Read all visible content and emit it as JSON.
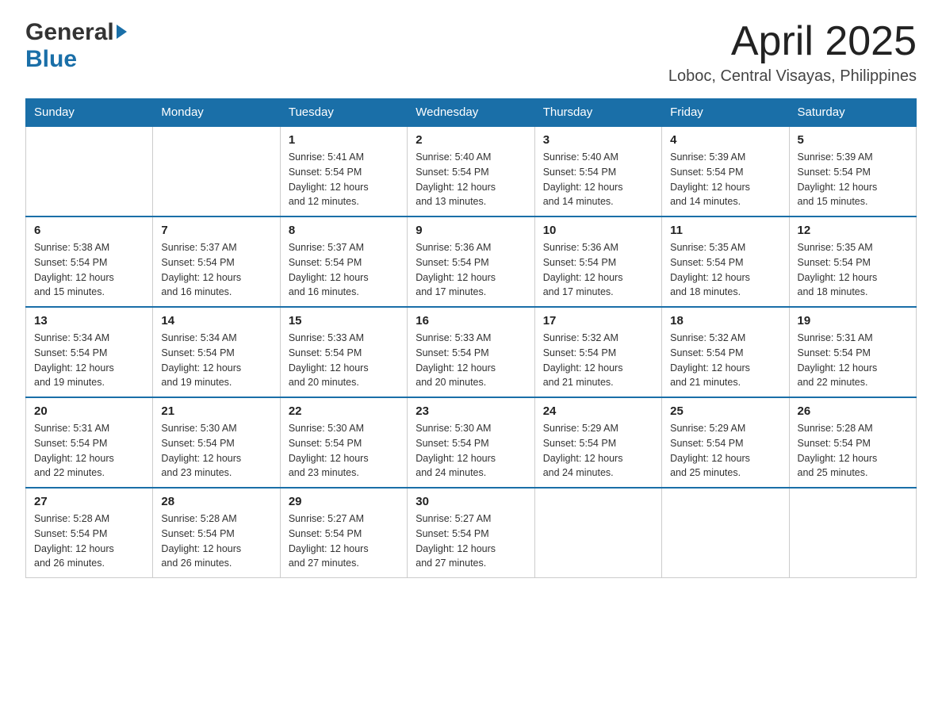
{
  "header": {
    "month_title": "April 2025",
    "location": "Loboc, Central Visayas, Philippines",
    "logo_general": "General",
    "logo_blue": "Blue"
  },
  "days_of_week": [
    "Sunday",
    "Monday",
    "Tuesday",
    "Wednesday",
    "Thursday",
    "Friday",
    "Saturday"
  ],
  "weeks": [
    [
      {
        "day": "",
        "info": ""
      },
      {
        "day": "",
        "info": ""
      },
      {
        "day": "1",
        "info": "Sunrise: 5:41 AM\nSunset: 5:54 PM\nDaylight: 12 hours\nand 12 minutes."
      },
      {
        "day": "2",
        "info": "Sunrise: 5:40 AM\nSunset: 5:54 PM\nDaylight: 12 hours\nand 13 minutes."
      },
      {
        "day": "3",
        "info": "Sunrise: 5:40 AM\nSunset: 5:54 PM\nDaylight: 12 hours\nand 14 minutes."
      },
      {
        "day": "4",
        "info": "Sunrise: 5:39 AM\nSunset: 5:54 PM\nDaylight: 12 hours\nand 14 minutes."
      },
      {
        "day": "5",
        "info": "Sunrise: 5:39 AM\nSunset: 5:54 PM\nDaylight: 12 hours\nand 15 minutes."
      }
    ],
    [
      {
        "day": "6",
        "info": "Sunrise: 5:38 AM\nSunset: 5:54 PM\nDaylight: 12 hours\nand 15 minutes."
      },
      {
        "day": "7",
        "info": "Sunrise: 5:37 AM\nSunset: 5:54 PM\nDaylight: 12 hours\nand 16 minutes."
      },
      {
        "day": "8",
        "info": "Sunrise: 5:37 AM\nSunset: 5:54 PM\nDaylight: 12 hours\nand 16 minutes."
      },
      {
        "day": "9",
        "info": "Sunrise: 5:36 AM\nSunset: 5:54 PM\nDaylight: 12 hours\nand 17 minutes."
      },
      {
        "day": "10",
        "info": "Sunrise: 5:36 AM\nSunset: 5:54 PM\nDaylight: 12 hours\nand 17 minutes."
      },
      {
        "day": "11",
        "info": "Sunrise: 5:35 AM\nSunset: 5:54 PM\nDaylight: 12 hours\nand 18 minutes."
      },
      {
        "day": "12",
        "info": "Sunrise: 5:35 AM\nSunset: 5:54 PM\nDaylight: 12 hours\nand 18 minutes."
      }
    ],
    [
      {
        "day": "13",
        "info": "Sunrise: 5:34 AM\nSunset: 5:54 PM\nDaylight: 12 hours\nand 19 minutes."
      },
      {
        "day": "14",
        "info": "Sunrise: 5:34 AM\nSunset: 5:54 PM\nDaylight: 12 hours\nand 19 minutes."
      },
      {
        "day": "15",
        "info": "Sunrise: 5:33 AM\nSunset: 5:54 PM\nDaylight: 12 hours\nand 20 minutes."
      },
      {
        "day": "16",
        "info": "Sunrise: 5:33 AM\nSunset: 5:54 PM\nDaylight: 12 hours\nand 20 minutes."
      },
      {
        "day": "17",
        "info": "Sunrise: 5:32 AM\nSunset: 5:54 PM\nDaylight: 12 hours\nand 21 minutes."
      },
      {
        "day": "18",
        "info": "Sunrise: 5:32 AM\nSunset: 5:54 PM\nDaylight: 12 hours\nand 21 minutes."
      },
      {
        "day": "19",
        "info": "Sunrise: 5:31 AM\nSunset: 5:54 PM\nDaylight: 12 hours\nand 22 minutes."
      }
    ],
    [
      {
        "day": "20",
        "info": "Sunrise: 5:31 AM\nSunset: 5:54 PM\nDaylight: 12 hours\nand 22 minutes."
      },
      {
        "day": "21",
        "info": "Sunrise: 5:30 AM\nSunset: 5:54 PM\nDaylight: 12 hours\nand 23 minutes."
      },
      {
        "day": "22",
        "info": "Sunrise: 5:30 AM\nSunset: 5:54 PM\nDaylight: 12 hours\nand 23 minutes."
      },
      {
        "day": "23",
        "info": "Sunrise: 5:30 AM\nSunset: 5:54 PM\nDaylight: 12 hours\nand 24 minutes."
      },
      {
        "day": "24",
        "info": "Sunrise: 5:29 AM\nSunset: 5:54 PM\nDaylight: 12 hours\nand 24 minutes."
      },
      {
        "day": "25",
        "info": "Sunrise: 5:29 AM\nSunset: 5:54 PM\nDaylight: 12 hours\nand 25 minutes."
      },
      {
        "day": "26",
        "info": "Sunrise: 5:28 AM\nSunset: 5:54 PM\nDaylight: 12 hours\nand 25 minutes."
      }
    ],
    [
      {
        "day": "27",
        "info": "Sunrise: 5:28 AM\nSunset: 5:54 PM\nDaylight: 12 hours\nand 26 minutes."
      },
      {
        "day": "28",
        "info": "Sunrise: 5:28 AM\nSunset: 5:54 PM\nDaylight: 12 hours\nand 26 minutes."
      },
      {
        "day": "29",
        "info": "Sunrise: 5:27 AM\nSunset: 5:54 PM\nDaylight: 12 hours\nand 27 minutes."
      },
      {
        "day": "30",
        "info": "Sunrise: 5:27 AM\nSunset: 5:54 PM\nDaylight: 12 hours\nand 27 minutes."
      },
      {
        "day": "",
        "info": ""
      },
      {
        "day": "",
        "info": ""
      },
      {
        "day": "",
        "info": ""
      }
    ]
  ]
}
